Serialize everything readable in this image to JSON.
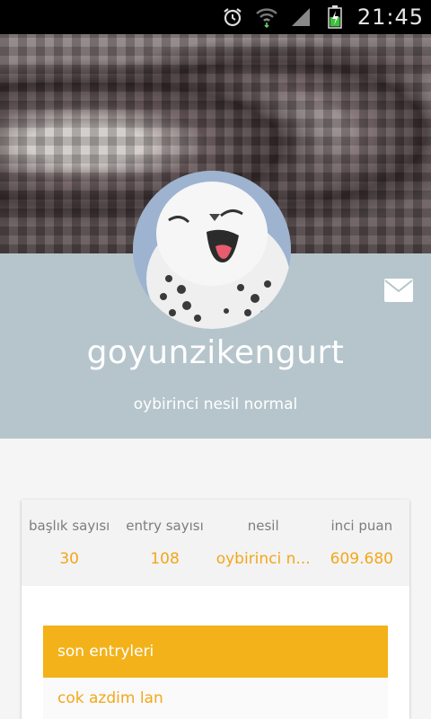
{
  "status_bar": {
    "time": "21:45",
    "icons": [
      "alarm-icon",
      "wifi-icon",
      "signal-icon",
      "battery-charging-icon"
    ]
  },
  "profile": {
    "username": "goyunzikengurt",
    "generation": "oybirinci nesil normal",
    "avatar": "snowy-owl-laughing"
  },
  "stats": [
    {
      "label": "başlık sayısı",
      "value": "30"
    },
    {
      "label": "entry sayısı",
      "value": "108"
    },
    {
      "label": "nesil",
      "value": "oybirinci n..."
    },
    {
      "label": "inci puan",
      "value": "609.680"
    }
  ],
  "entries": {
    "header": "son entryleri",
    "items": [
      "cok azdim lan"
    ]
  },
  "colors": {
    "accent": "#f3b21a",
    "band": "#b6c5cc"
  }
}
